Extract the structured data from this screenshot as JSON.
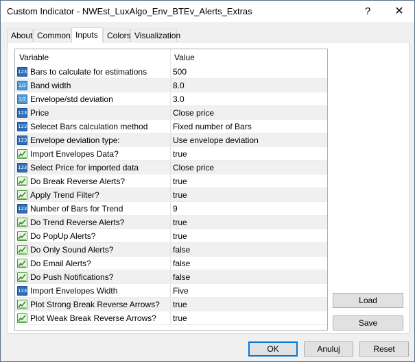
{
  "window": {
    "title": "Custom Indicator - NWEst_LuxAlgo_Env_BTEv_Alerts_Extras",
    "help_glyph": "?",
    "close_glyph": "✕"
  },
  "tabs": [
    {
      "label": "About"
    },
    {
      "label": "Common"
    },
    {
      "label": "Inputs"
    },
    {
      "label": "Colors"
    },
    {
      "label": "Visualization"
    }
  ],
  "active_tab": "Inputs",
  "grid": {
    "header": {
      "variable": "Variable",
      "value": "Value"
    },
    "rows": [
      {
        "icon": "123",
        "name": "Bars to calculate for estimations",
        "value": "500"
      },
      {
        "icon": "1/2",
        "name": "Band width",
        "value": "8.0"
      },
      {
        "icon": "1/2",
        "name": "Envelope/std deviation",
        "value": "3.0"
      },
      {
        "icon": "123",
        "name": "Price",
        "value": "Close price"
      },
      {
        "icon": "123",
        "name": "Selecet Bars calculation method",
        "value": "Fixed number of Bars"
      },
      {
        "icon": "123",
        "name": "Envelope deviation type:",
        "value": "Use envelope deviation"
      },
      {
        "icon": "bool",
        "name": "Import Envelopes Data?",
        "value": "true"
      },
      {
        "icon": "123",
        "name": "Select Price for imported data",
        "value": "Close price"
      },
      {
        "icon": "bool",
        "name": "Do Break Reverse Alerts?",
        "value": "true"
      },
      {
        "icon": "bool",
        "name": "Apply Trend Filter?",
        "value": "true"
      },
      {
        "icon": "123",
        "name": "Number of Bars for Trend",
        "value": "9"
      },
      {
        "icon": "bool",
        "name": "Do Trend Reverse Alerts?",
        "value": "true"
      },
      {
        "icon": "bool",
        "name": "Do PopUp Alerts?",
        "value": "true"
      },
      {
        "icon": "bool",
        "name": "Do Only Sound Alerts?",
        "value": "false"
      },
      {
        "icon": "bool",
        "name": "Do Email Alerts?",
        "value": "false"
      },
      {
        "icon": "bool",
        "name": "Do Push Notifications?",
        "value": "false"
      },
      {
        "icon": "123",
        "name": "Import Envelopes Width",
        "value": "Five"
      },
      {
        "icon": "bool",
        "name": "Plot Strong Break Reverse Arrows?",
        "value": "true"
      },
      {
        "icon": "bool",
        "name": "Plot Weak Break Reverse Arrows?",
        "value": "true"
      }
    ]
  },
  "buttons": {
    "load": "Load",
    "save": "Save",
    "ok": "OK",
    "cancel": "Anuluj",
    "reset": "Reset"
  }
}
